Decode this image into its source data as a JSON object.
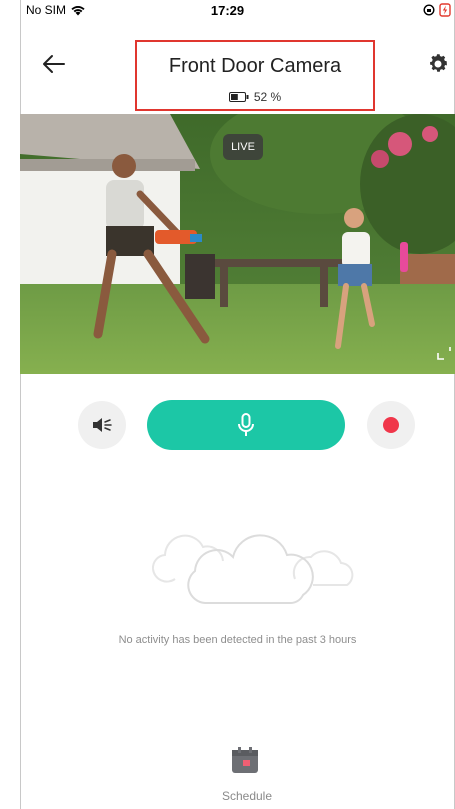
{
  "status_bar": {
    "carrier": "No SIM",
    "time": "17:29"
  },
  "header": {
    "title": "Front Door Camera",
    "battery": "52 %",
    "battery_level": 0.52,
    "back_icon": "arrow-left-icon",
    "settings_icon": "gear-icon",
    "highlight_color": "#e0362f"
  },
  "video": {
    "live_label": "LIVE",
    "fullscreen_icon": "fullscreen-icon"
  },
  "controls": {
    "mute_icon": "speaker-mute-icon",
    "talk_icon": "microphone-icon",
    "talk_color": "#1cc7a6",
    "record_icon": "record-icon",
    "record_color": "#f0364a"
  },
  "activity": {
    "empty_message": "No activity has been detected in the past 3 hours",
    "empty_icon": "clouds-icon"
  },
  "bottom": {
    "schedule_label": "Schedule",
    "schedule_icon": "calendar-icon"
  }
}
